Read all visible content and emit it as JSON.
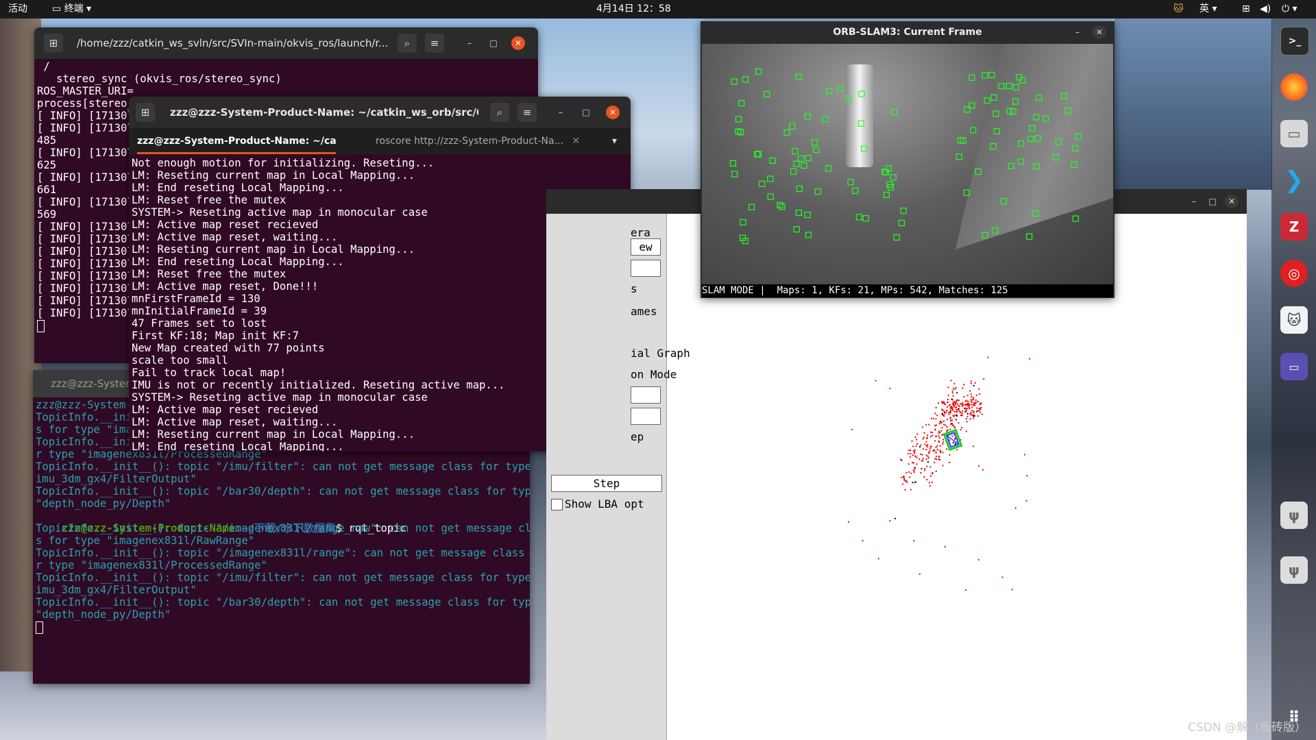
{
  "topbar": {
    "activities": "活动",
    "app_menu": "终端",
    "clock": "4月14日  12：58",
    "input_method": "英"
  },
  "term_back": {
    "title": "/home/zzz/catkin_ws_svln/src/SVIn-main/okvis_ros/launch/r...",
    "lines": [
      " /",
      "   stereo_sync (okvis_ros/stereo_sync)",
      "",
      "ROS_MASTER_URI=",
      "",
      "process[stereo_",
      "[ INFO] [171307",
      "[ INFO] [171307",
      "485",
      "[ INFO] [171307",
      "625",
      "[ INFO] [171307",
      "661",
      "[ INFO] [171307",
      "569",
      "[ INFO] [171307",
      "[ INFO] [171307",
      "[ INFO] [171307",
      "[ INFO] [171307",
      "[ INFO] [171307",
      "[ INFO] [171307",
      "[ INFO] [171307",
      "[ INFO] [171307"
    ]
  },
  "term_bottom": {
    "title": "zzz@zzz-System",
    "prompt_user": "zzz@zzz-System-Product-Name",
    "prompt_path": "~/下载/水下数据集",
    "command": "$ rqt_topic",
    "lines_top": [
      "zzz@zzz-System-",
      "TopicInfo.__ini",
      "s for type \"ima",
      "TopicInfo.__ini",
      "r type \"imagenex831l/ProcessedRange\"",
      "TopicInfo.__init__(): topic \"/imu/filter\": can not get message class for type \"",
      "imu_3dm_gx4/FilterOutput\"",
      "TopicInfo.__init__(): topic \"/bar30/depth\": can not get message class for type",
      "\"depth_node_py/Depth\""
    ],
    "lines_after": [
      "TopicInfo.__init__(): topic \"/imagenex831l/range_raw\": can not get message clas",
      "s for type \"imagenex831l/RawRange\"",
      "TopicInfo.__init__(): topic \"/imagenex831l/range\": can not get message class fo",
      "r type \"imagenex831l/ProcessedRange\"",
      "TopicInfo.__init__(): topic \"/imu/filter\": can not get message class for type \"",
      "imu_3dm_gx4/FilterOutput\"",
      "TopicInfo.__init__(): topic \"/bar30/depth\": can not get message class for type",
      "\"depth_node_py/Depth\""
    ]
  },
  "term_front": {
    "title": "zzz@zzz-System-Product-Name: ~/catkin_ws_orb/src/ORB_SL...",
    "tab1": "zzz@zzz-System-Product-Name: ~/cat...",
    "tab2": "roscore http://zzz-System-Product-Na...",
    "lines": [
      "Not enough motion for initializing. Reseting...",
      "LM: Reseting current map in Local Mapping...",
      "LM: End reseting Local Mapping...",
      "LM: Reset free the mutex",
      "SYSTEM-> Reseting active map in monocular case",
      "LM: Active map reset recieved",
      "LM: Active map reset, waiting...",
      "LM: Reseting current map in Local Mapping...",
      "LM: End reseting Local Mapping...",
      "LM: Reset free the mutex",
      "LM: Active map reset, Done!!!",
      "mnFirstFrameId = 130",
      "mnInitialFrameId = 39",
      "47 Frames set to lost",
      "First KF:18; Map init KF:7",
      "New Map created with 77 points",
      "scale too small",
      "Fail to track local map!",
      "IMU is not or recently initialized. Reseting active map...",
      "SYSTEM-> Reseting active map in monocular case",
      "LM: Active map reset recieved",
      "LM: Active map reset, waiting...",
      "LM: Reseting current map in Local Mapping...",
      "LM: End reseting Local Mapping..."
    ]
  },
  "orb": {
    "title": "ORB-SLAM3: Current Frame",
    "status": "SLAM MODE |  Maps: 1, KFs: 21, MPs: 542, Matches: 125"
  },
  "viewer": {
    "labels": [
      "era",
      "ew",
      "",
      "s",
      "ames",
      "",
      "ial Graph",
      "on Mode"
    ],
    "label_ep": "ep",
    "step_button": "Step",
    "show_lba": "Show LBA opt"
  },
  "watermark": "CSDN @解（板砖版）",
  "colors": {
    "terminal_bg": "#300a24",
    "accent": "#e95420",
    "feature_green": "#22ff22"
  }
}
